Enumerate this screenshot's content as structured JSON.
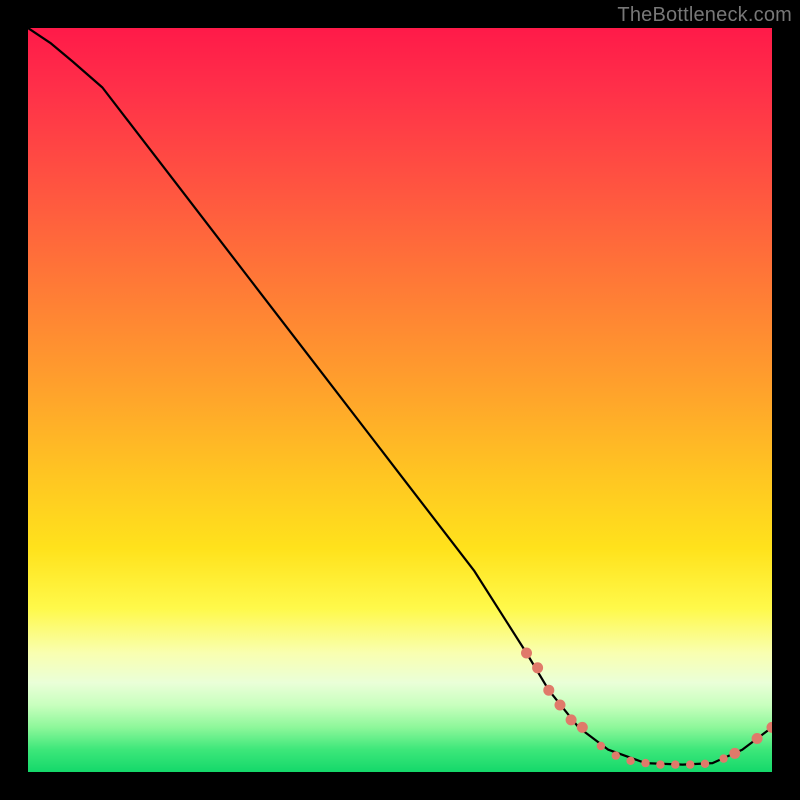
{
  "watermark": "TheBottleneck.com",
  "chart_data": {
    "type": "line",
    "title": "",
    "xlabel": "",
    "ylabel": "",
    "xlim": [
      0,
      100
    ],
    "ylim": [
      0,
      100
    ],
    "grid": false,
    "legend": false,
    "series": [
      {
        "name": "bottleneck-curve",
        "x": [
          0,
          3,
          6,
          10,
          20,
          30,
          40,
          50,
          60,
          67,
          70,
          74,
          78,
          83,
          88,
          92,
          96,
          100
        ],
        "values": [
          100,
          98,
          95.5,
          92,
          79,
          66,
          53,
          40,
          27,
          16,
          11,
          6,
          3,
          1.2,
          1.0,
          1.2,
          3,
          6
        ]
      }
    ],
    "points_overlay": {
      "name": "highlight-dots",
      "x": [
        67,
        68.5,
        70,
        71.5,
        73,
        74.5,
        77,
        79,
        81,
        83,
        85,
        87,
        89,
        91,
        93.5,
        95,
        98,
        100
      ],
      "values": [
        16,
        14,
        11,
        9,
        7,
        6,
        3.5,
        2.2,
        1.5,
        1.2,
        1.0,
        1.0,
        1.0,
        1.1,
        1.8,
        2.5,
        4.5,
        6
      ]
    }
  }
}
